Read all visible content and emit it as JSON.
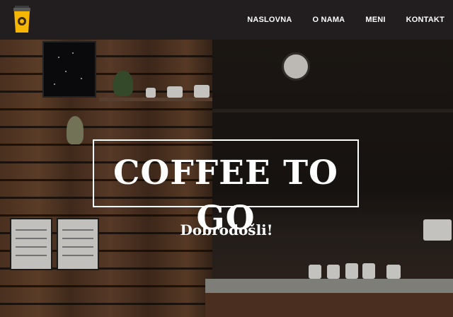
{
  "navbar": {
    "logo_icon": "coffee-cup-icon",
    "links": [
      "NASLOVNA",
      "O NAMA",
      "MENI",
      "KONTAKT"
    ]
  },
  "hero": {
    "title": "COFFEE TO GO",
    "subtitle": "Dobrodošli!"
  },
  "colors": {
    "navbar_bg": "#221d1e",
    "text": "#ffffff",
    "logo_cup": "#f5b700"
  }
}
